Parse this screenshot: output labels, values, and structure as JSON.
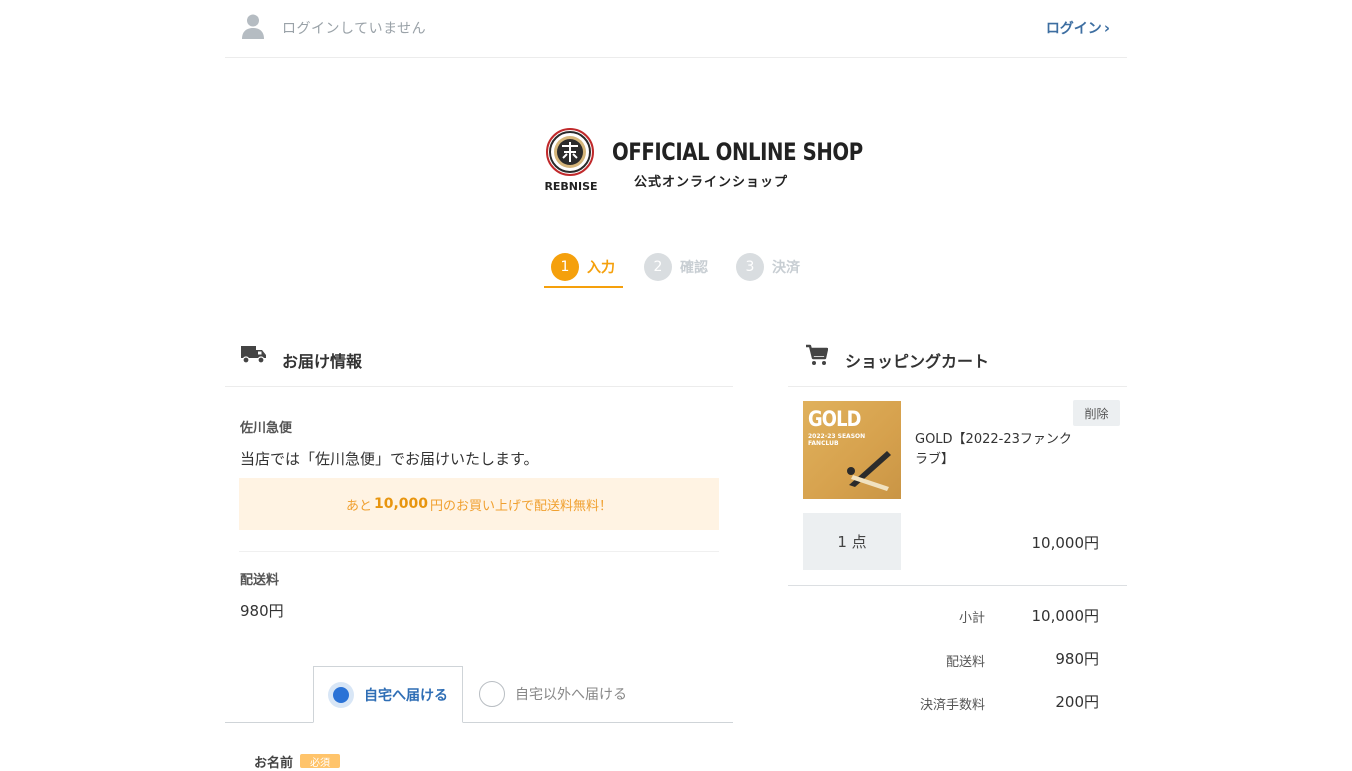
{
  "header": {
    "login_status": "ログインしていません",
    "login_link": "ログイン"
  },
  "brand": {
    "logo_text": "REBNISE",
    "title": "OFFICIAL ONLINE SHOP",
    "subtitle": "公式オンラインショップ"
  },
  "steps": [
    {
      "num": "1",
      "label": "入力",
      "active": true
    },
    {
      "num": "2",
      "label": "確認",
      "active": false
    },
    {
      "num": "3",
      "label": "決済",
      "active": false
    }
  ],
  "delivery": {
    "title": "お届け情報",
    "carrier_label": "佐川急便",
    "carrier_desc": "当店では「佐川急便」でお届けいたします。",
    "free_ship_prefix": "あと",
    "free_ship_amount": "10,000",
    "free_ship_suffix": "円のお買い上げで配送料無料！",
    "shipping_label": "配送料",
    "shipping_value": "980円",
    "tabs": {
      "home": "自宅へ届ける",
      "other": "自宅以外へ届ける"
    },
    "name_label": "お名前",
    "required": "必須"
  },
  "cart": {
    "title": "ショッピングカート",
    "item": {
      "thumb_title": "GOLD",
      "thumb_sub_1": "2022-23 SEASON",
      "thumb_sub_2": "FANCLUB",
      "name": "GOLD【2022-23ファンクラブ】",
      "delete_label": "削除",
      "qty": "1 点",
      "price": "10,000円"
    },
    "summary": {
      "subtotal_label": "小計",
      "subtotal_value": "10,000円",
      "shipping_label": "配送料",
      "shipping_value": "980円",
      "fee_label": "決済手数料",
      "fee_value": "200円"
    }
  },
  "colors": {
    "accent_orange": "#f5a00c",
    "link_blue": "#3d6ea1",
    "radio_blue": "#2a72d6"
  }
}
